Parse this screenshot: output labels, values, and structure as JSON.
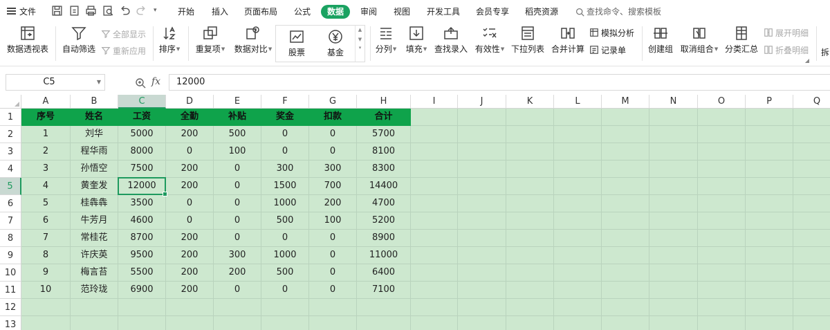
{
  "menubar": {
    "file_label": "文件",
    "tabs": [
      {
        "label": "开始",
        "active": false
      },
      {
        "label": "插入",
        "active": false
      },
      {
        "label": "页面布局",
        "active": false
      },
      {
        "label": "公式",
        "active": false
      },
      {
        "label": "数据",
        "active": true
      },
      {
        "label": "审阅",
        "active": false
      },
      {
        "label": "视图",
        "active": false
      },
      {
        "label": "开发工具",
        "active": false
      },
      {
        "label": "会员专享",
        "active": false
      },
      {
        "label": "稻壳资源",
        "active": false
      }
    ],
    "search_label": "查找命令、搜索模板",
    "accent_color": "#1aa261"
  },
  "ribbon": {
    "pivot": "数据透视表",
    "autofilter": "自动筛选",
    "show_all": "全部显示",
    "reapply": "重新应用",
    "sort": "排序",
    "duplicates": "重复项",
    "compare": "数据对比",
    "stock": "股票",
    "fund": "基金",
    "split": "分列",
    "fill": "填充",
    "lookup_entry": "查找录入",
    "validity": "有效性",
    "dropdown_list": "下拉列表",
    "consolidate": "合并计算",
    "what_if": "模拟分析",
    "record_form": "记录单",
    "create_group": "创建组",
    "ungroup": "取消组合",
    "subtotal": "分类汇总",
    "expand_detail": "展开明细",
    "collapse_detail": "折叠明细",
    "more": "拆"
  },
  "formulabar": {
    "name_box": "C5",
    "fx_label": "fx",
    "value": "12000"
  },
  "grid": {
    "columns": [
      "A",
      "B",
      "C",
      "D",
      "E",
      "F",
      "G",
      "H",
      "I",
      "J",
      "K",
      "L",
      "M",
      "N",
      "O",
      "P",
      "Q"
    ],
    "rows": [
      "1",
      "2",
      "3",
      "4",
      "5",
      "6",
      "7",
      "8",
      "9",
      "10",
      "11",
      "12",
      "13"
    ],
    "selected_cell": "C5",
    "header_fill": "#0fa34b",
    "sheet_fill": "#cde8cf",
    "table_headers": [
      "序号",
      "姓名",
      "工资",
      "全勤",
      "补贴",
      "奖金",
      "扣款",
      "合计"
    ],
    "table_rows": [
      [
        "1",
        "刘华",
        "5000",
        "200",
        "500",
        "0",
        "0",
        "5700"
      ],
      [
        "2",
        "程华雨",
        "8000",
        "0",
        "100",
        "0",
        "0",
        "8100"
      ],
      [
        "3",
        "孙悟空",
        "7500",
        "200",
        "0",
        "300",
        "300",
        "8300"
      ],
      [
        "4",
        "黄奎发",
        "12000",
        "200",
        "0",
        "1500",
        "700",
        "14400"
      ],
      [
        "5",
        "桂犇犇",
        "3500",
        "0",
        "0",
        "1000",
        "200",
        "4700"
      ],
      [
        "6",
        "牛芳月",
        "4600",
        "0",
        "0",
        "500",
        "100",
        "5200"
      ],
      [
        "7",
        "常桂花",
        "8700",
        "200",
        "0",
        "0",
        "0",
        "8900"
      ],
      [
        "8",
        "许庆英",
        "9500",
        "200",
        "300",
        "1000",
        "0",
        "11000"
      ],
      [
        "9",
        "梅言苔",
        "5500",
        "200",
        "200",
        "500",
        "0",
        "6400"
      ],
      [
        "10",
        "范玲珑",
        "6900",
        "200",
        "0",
        "0",
        "0",
        "7100"
      ]
    ]
  }
}
